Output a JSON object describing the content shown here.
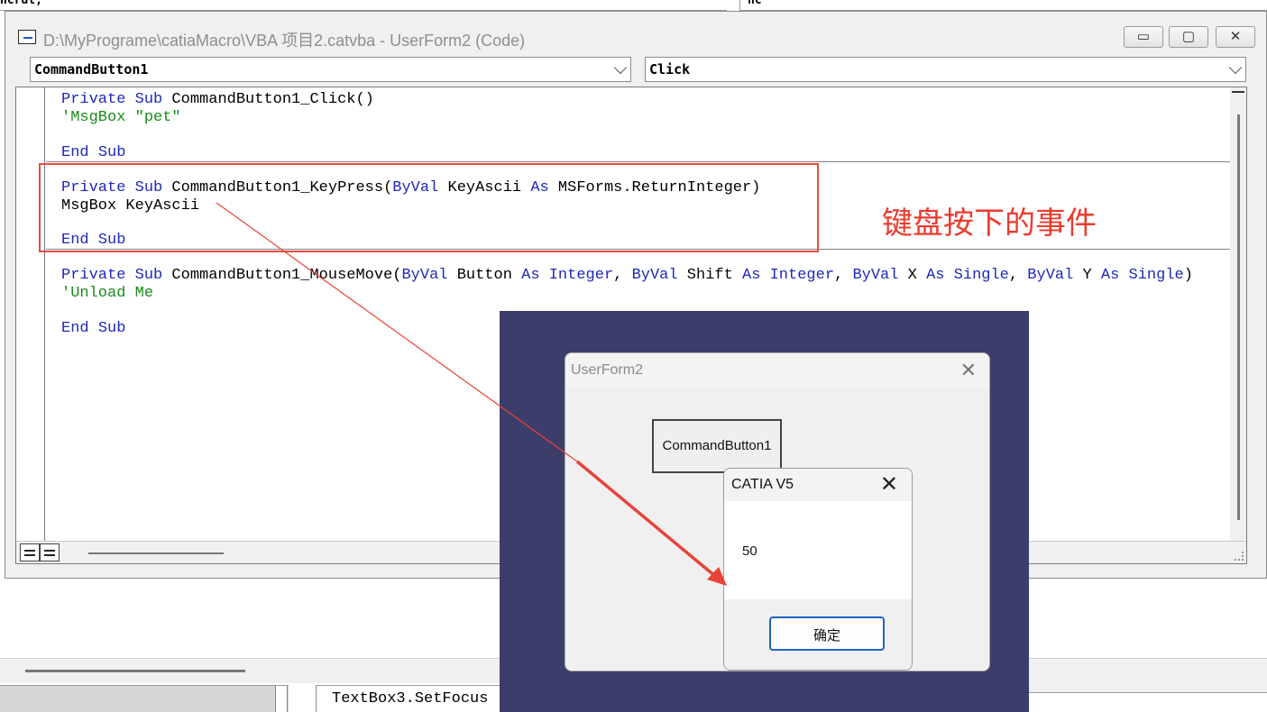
{
  "background": {
    "top_left_code": "ncrdl;",
    "top_right_code": "nc",
    "lower_code": "TextBox3.SetFocus"
  },
  "window": {
    "title": "D:\\MyPrograme\\catiaMacro\\VBA 项目2.catvba - UserForm2 (Code)",
    "minimize_glyph": "▭",
    "maximize_glyph": "▢",
    "close_glyph": "✕"
  },
  "object_dropdown": {
    "value": "CommandButton1"
  },
  "procedure_dropdown": {
    "value": "Click"
  },
  "code": {
    "proc1": {
      "l1_kw1": "Private",
      "l1_kw2": "Sub",
      "l1_rest": " CommandButton1_Click()",
      "l2": "'MsgBox \"pet\"",
      "l3_kw": "End",
      "l3_kw2": "Sub"
    },
    "proc2": {
      "l1_kw1": "Private",
      "l1_kw2": "Sub",
      "l1_name": " CommandButton1_KeyPress(",
      "l1_kw3": "ByVal",
      "l1_arg": " KeyAscii ",
      "l1_kw4": "As",
      "l1_type": " MSForms.ReturnInteger)",
      "l2": "MsgBox KeyAscii",
      "l3_kw": "End",
      "l3_kw2": "Sub"
    },
    "proc3": {
      "l1_kw1": "Private",
      "l1_kw2": "Sub",
      "l1_name": " CommandButton1_MouseMove(",
      "l1_byval1": "ByVal",
      "l1_a1": " Button ",
      "l1_as1": "As",
      "l1_t1": " Integer",
      "l1_c1": ", ",
      "l1_byval2": "ByVal",
      "l1_a2": " Shift ",
      "l1_as2": "As",
      "l1_t2": " Integer",
      "l1_c2": ", ",
      "l1_byval3": "ByVal",
      "l1_a3": " X ",
      "l1_as3": "As",
      "l1_t3": " Single",
      "l1_c3": ", ",
      "l1_byval4": "ByVal",
      "l1_a4": " Y ",
      "l1_as4": "As",
      "l1_t4": " Single",
      "l1_end": ")",
      "l2": "'Unload Me",
      "l3_kw": "End",
      "l3_kw2": "Sub"
    }
  },
  "annotation": {
    "text": "键盘按下的事件",
    "color": "#ed3b2d"
  },
  "userform": {
    "title": "UserForm2",
    "close_glyph": "✕",
    "button_label": "CommandButton1"
  },
  "msgbox": {
    "title": "CATIA V5",
    "close_glyph": "✕",
    "message": "50",
    "ok_label": "确定"
  },
  "colors": {
    "keyword": "#1f28b8",
    "comment": "#1a8a1a",
    "annotation_red": "#e84c3d",
    "runtime_bg": "#3d3d6b"
  }
}
